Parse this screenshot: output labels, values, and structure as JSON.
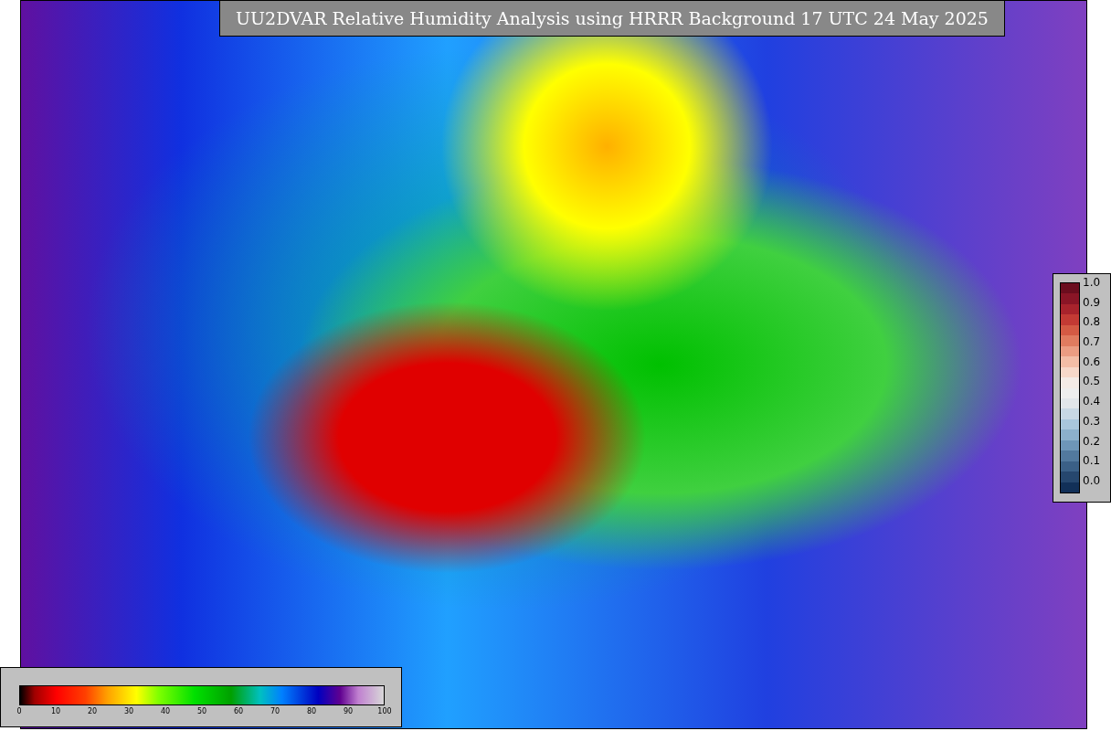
{
  "title": "UU2DVAR Relative Humidity Analysis using HRRR Background 17 UTC 24 May 2025",
  "right_colorbar": {
    "ticks": [
      "1.0",
      "0.9",
      "0.8",
      "0.7",
      "0.6",
      "0.5",
      "0.4",
      "0.3",
      "0.2",
      "0.1",
      "0.0"
    ]
  },
  "bottom_colorbar": {
    "ticks": [
      "0",
      "10",
      "20",
      "30",
      "40",
      "50",
      "60",
      "70",
      "80",
      "90",
      "100"
    ]
  }
}
